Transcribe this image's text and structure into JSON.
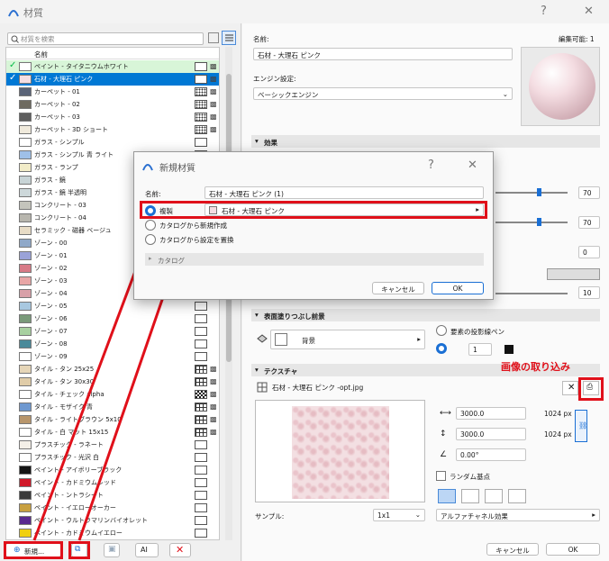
{
  "window": {
    "title": "材質",
    "help": "?",
    "close": "✕"
  },
  "search": {
    "placeholder": "材質を検索"
  },
  "list": {
    "header": "名前",
    "items": [
      {
        "name": "ペイント - タイタニウムホワイト",
        "color": "#ffffff",
        "pattern": "plain",
        "checked": true,
        "state": "chk"
      },
      {
        "name": "石材 - 大理石 ピンク",
        "color": "#f4dde2",
        "pattern": "plain",
        "checked": true,
        "state": "sel"
      },
      {
        "name": "カーペット - 01",
        "color": "#5a6478",
        "pattern": "dots"
      },
      {
        "name": "カーペット - 02",
        "color": "#6e6a60",
        "pattern": "dots"
      },
      {
        "name": "カーペット - 03",
        "color": "#5e5e5e",
        "pattern": "dots"
      },
      {
        "name": "カーペット - 3D ショート",
        "color": "#f0eadc",
        "pattern": "dots"
      },
      {
        "name": "ガラス - シンプル",
        "color": "#ffffff",
        "pattern": "plain"
      },
      {
        "name": "ガラス - シンプル 青 ライト",
        "color": "#9fc0e8",
        "pattern": "plain"
      },
      {
        "name": "ガラス - ランプ",
        "color": "#f2ecc8",
        "pattern": "plain"
      },
      {
        "name": "ガラス - 鏡",
        "color": "#c8d4d6",
        "pattern": "plain"
      },
      {
        "name": "ガラス - 鏡 半透明",
        "color": "#cdd8da",
        "pattern": "plain"
      },
      {
        "name": "コンクリート - 03",
        "color": "#c4c4bc",
        "pattern": "plain"
      },
      {
        "name": "コンクリート - 04",
        "color": "#b8b6ae",
        "pattern": "plain"
      },
      {
        "name": "セラミック - 磁器 ベージュ",
        "color": "#e8dcc6",
        "pattern": "plain"
      },
      {
        "name": "ゾーン - 00",
        "color": "#8fa8c8",
        "pattern": "plain"
      },
      {
        "name": "ゾーン - 01",
        "color": "#9aa2d8",
        "pattern": "plain"
      },
      {
        "name": "ゾーン - 02",
        "color": "#d87a86",
        "pattern": "plain"
      },
      {
        "name": "ゾーン - 03",
        "color": "#e8a6a6",
        "pattern": "plain"
      },
      {
        "name": "ゾーン - 04",
        "color": "#d8a0a8",
        "pattern": "plain"
      },
      {
        "name": "ゾーン - 05",
        "color": "#a8c8e0",
        "pattern": "plain"
      },
      {
        "name": "ゾーン - 06",
        "color": "#7a9a7a",
        "pattern": "plain"
      },
      {
        "name": "ゾーン - 07",
        "color": "#a8d0a0",
        "pattern": "plain"
      },
      {
        "name": "ゾーン - 08",
        "color": "#4a8a9a",
        "pattern": "plain"
      },
      {
        "name": "ゾーン - 09",
        "color": "#ffffff",
        "pattern": "plain"
      },
      {
        "name": "タイル - タン 25x25",
        "color": "#e6d6b8",
        "pattern": "grid"
      },
      {
        "name": "タイル - タン 30x30",
        "color": "#e0cca8",
        "pattern": "grid"
      },
      {
        "name": "タイル - チェック alpha",
        "color": "#ffffff",
        "pattern": "chess"
      },
      {
        "name": "タイル - モザイク 青",
        "color": "#6e98d0",
        "pattern": "grid"
      },
      {
        "name": "タイル - ライトブラウン 5x10",
        "color": "#b8966c",
        "pattern": "grid"
      },
      {
        "name": "タイル - 白 マット 15x15",
        "color": "#ffffff",
        "pattern": "grid"
      },
      {
        "name": "プラスチック - ラネート",
        "color": "#f4f0e8",
        "pattern": "plain"
      },
      {
        "name": "プラスチック - 光沢 白",
        "color": "#ffffff",
        "pattern": "plain"
      },
      {
        "name": "ペイント - アイボリーブラック",
        "color": "#141414",
        "pattern": "plain"
      },
      {
        "name": "ペイント - カドミウムレッド",
        "color": "#d01828",
        "pattern": "plain"
      },
      {
        "name": "ペイント - ントラシート",
        "color": "#3a3a3a",
        "pattern": "plain"
      },
      {
        "name": "ペイント - イエローオーカー",
        "color": "#c8a040",
        "pattern": "plain"
      },
      {
        "name": "ペイント - ウルトラマリンバイオレット",
        "color": "#5a2a90",
        "pattern": "plain"
      },
      {
        "name": "ペイント - カドミウムイエロー",
        "color": "#f0d010",
        "pattern": "plain"
      }
    ]
  },
  "bottom": {
    "new_label": "新規..."
  },
  "right": {
    "name_label": "名前:",
    "editable": "編集可能: 1",
    "name_value": "石材 - 大理石 ピンク",
    "engine_label": "エンジン設定:",
    "engine_value": "ベーシックエンジン",
    "effects_header": "効果",
    "values": [
      "70",
      "70",
      "0",
      "10"
    ],
    "surface_header": "表面塗りつぶし前景",
    "surface_value": "背景",
    "pen_label": "要素の投影線ペン",
    "pen_value": "1",
    "texture_header": "テクスチャ",
    "texture_file": "石材 - 大理石 ピンク -opt.jpg",
    "annotation": "画像の取り込み",
    "width": "3000.0",
    "height": "3000.0",
    "width_px": "1024 px",
    "height_px": "1024 px",
    "angle": "0.00°",
    "random": "ランダム基点",
    "sample_label": "サンプル:",
    "sample_value": "1x1",
    "alpha_value": "アルファチャネル効果",
    "cancel": "キャンセル",
    "ok": "OK"
  },
  "dialog": {
    "title": "新規材質",
    "help": "?",
    "close": "✕",
    "name_label": "名前:",
    "name_value": "石材 - 大理石 ピンク (1)",
    "opt_duplicate": "複製",
    "duplicate_source": "石材 - 大理石 ピンク",
    "opt_catalog": "カタログから新規作成",
    "opt_replace": "カタログから設定を置換",
    "catalog": "カタログ",
    "cancel": "キャンセル",
    "ok": "OK"
  }
}
